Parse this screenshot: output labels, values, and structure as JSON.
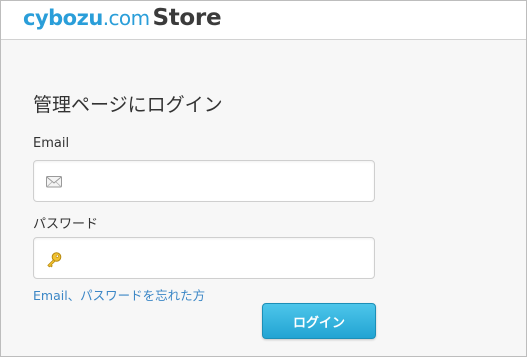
{
  "header": {
    "logo_brand": "cybozu",
    "logo_tld": ".com",
    "logo_store": "Store"
  },
  "login": {
    "title": "管理ページにログイン",
    "email_label": "Email",
    "email_value": "",
    "password_label": "パスワード",
    "password_value": "",
    "forgot_link": "Email、パスワードを忘れた方",
    "submit_label": "ログイン"
  },
  "icons": {
    "email_field_icon": "envelope-icon",
    "password_field_icon": "key-icon"
  },
  "colors": {
    "brand_blue": "#2a9ed9",
    "link_blue": "#3c87c6",
    "button_top": "#4dc6ea",
    "button_bottom": "#22a4d3",
    "page_background": "#f7f7f7"
  }
}
